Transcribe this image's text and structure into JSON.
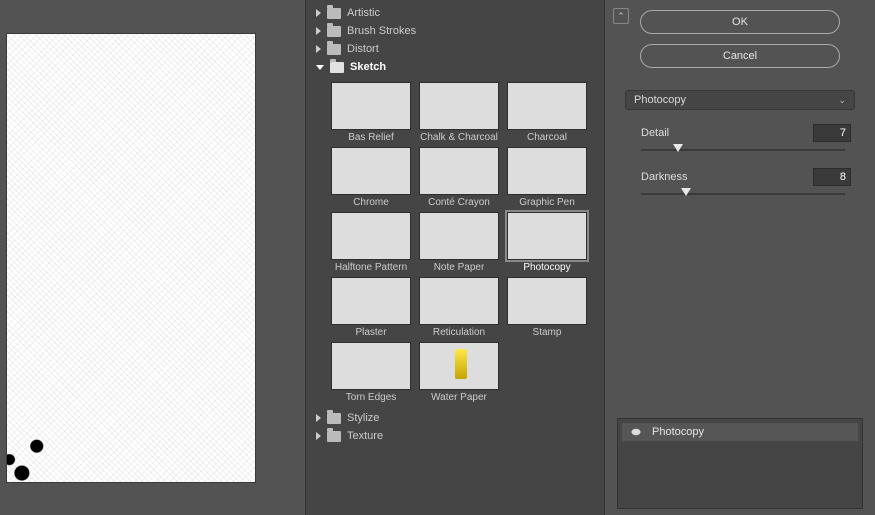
{
  "buttons": {
    "ok": "OK",
    "cancel": "Cancel"
  },
  "dropdown": {
    "selected": "Photocopy"
  },
  "params": {
    "detail": {
      "label": "Detail",
      "value": "7",
      "handle_pct": 18
    },
    "darkness": {
      "label": "Darkness",
      "value": "8",
      "handle_pct": 22
    }
  },
  "folders": {
    "artistic": "Artistic",
    "brush": "Brush Strokes",
    "distort": "Distort",
    "sketch": "Sketch",
    "stylize": "Stylize",
    "texture": "Texture"
  },
  "thumbs": {
    "bas": "Bas Relief",
    "chalk": "Chalk & Charcoal",
    "char": "Charcoal",
    "chrome": "Chrome",
    "conte": "Conté Crayon",
    "gp": "Graphic Pen",
    "ht": "Halftone Pattern",
    "np": "Note Paper",
    "pc": "Photocopy",
    "plaster": "Plaster",
    "retic": "Reticulation",
    "stamp": "Stamp",
    "torn": "Torn Edges",
    "wp": "Water Paper"
  },
  "layer": {
    "name": "Photocopy"
  }
}
